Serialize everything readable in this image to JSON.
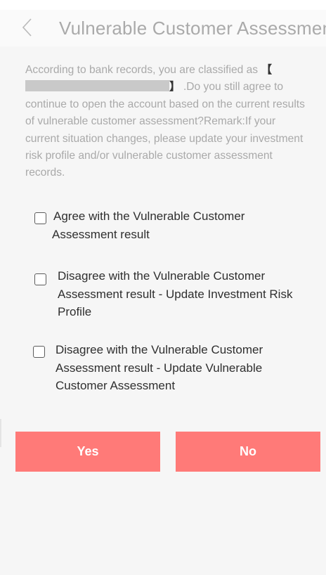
{
  "header": {
    "title": "Vulnerable Customer Assessment r",
    "back_icon": "chevron-left-icon"
  },
  "notice": {
    "line1": "According to bank records, you are classified as ",
    "open_bracket": "【",
    "close_bracket": "】",
    "line2": " .Do you still agree to continue to open the account based on the current results of vulnerable customer assessment?Remark:If your current situation changes, please update your investment risk profile and/or vulnerable customer assessment records."
  },
  "options": [
    {
      "label": "Agree with the Vulnerable Customer Assessment result",
      "checked": false
    },
    {
      "label": "Disagree with the Vulnerable Customer Assessment result - Update Investment Risk Profile",
      "checked": false
    },
    {
      "label": "Disagree with the Vulnerable Customer Assessment result - Update Vulnerable Customer Assessment",
      "checked": false
    }
  ],
  "buttons": {
    "yes": "Yes",
    "no": "No"
  },
  "colors": {
    "button": "#ff7a78",
    "background": "#f6f6f6",
    "description_text": "#a9a9a9",
    "option_text": "#2f2f2f"
  }
}
